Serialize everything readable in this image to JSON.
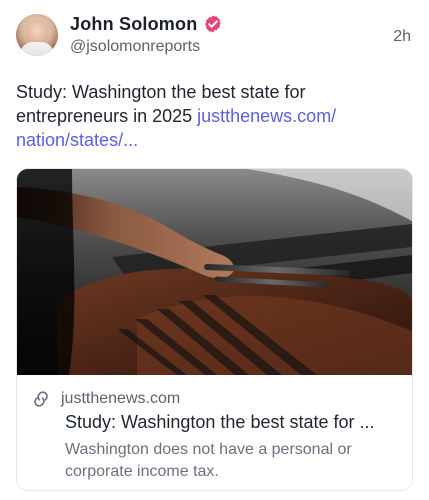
{
  "post": {
    "author": {
      "display_name": "John Solomon",
      "handle": "@jsolomonreports",
      "verified": true
    },
    "time_ago": "2h",
    "text_prefix": "Study: Washington the best state for entrepreneurs in 2025 ",
    "text_link": "justthenews.com/ nation/states/...",
    "colors": {
      "link": "#5a5fe6",
      "verified": "#e5447a"
    },
    "icons": {
      "verified": "verified-badge-icon",
      "link": "link-icon",
      "avatar": "avatar"
    }
  },
  "card": {
    "domain": "justthenews.com",
    "title": "Study: Washington the best state for ...",
    "description": "Washington does not have a personal or corporate income tax."
  }
}
